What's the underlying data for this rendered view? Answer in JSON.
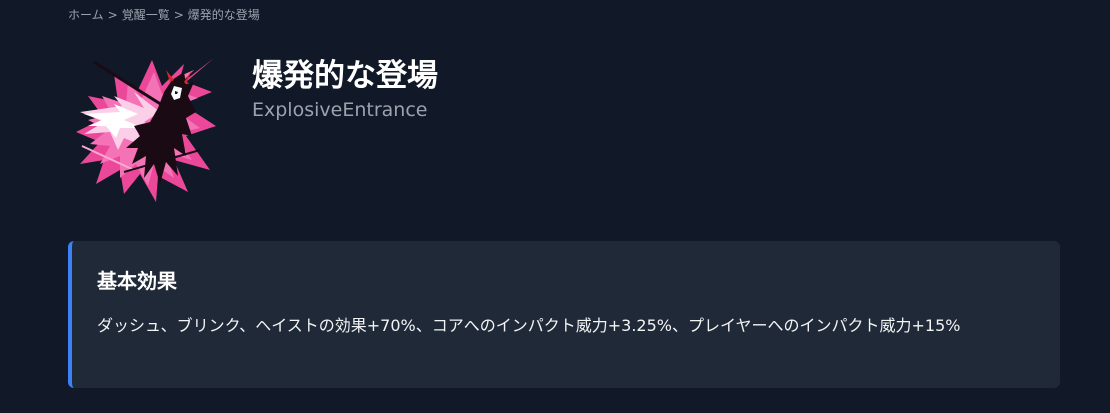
{
  "breadcrumb": {
    "home": "ホーム",
    "list": "覚醒一覧",
    "current": "爆発的な登場",
    "separator": ">"
  },
  "header": {
    "title": "爆発的な登場",
    "subtitle": "ExplosiveEntrance",
    "icon": "explosive-entrance-art"
  },
  "effect_card": {
    "heading": "基本効果",
    "description": "ダッシュ、ブリンク、ヘイストの効果+70%、コアへのインパクト威力+3.25%、プレイヤーへのインパクト威力+15%"
  },
  "colors": {
    "background": "#111827",
    "card_background": "#1f2937",
    "accent": "#3b82f6",
    "art_pink": "#ec4899",
    "art_magenta": "#d946ef"
  }
}
